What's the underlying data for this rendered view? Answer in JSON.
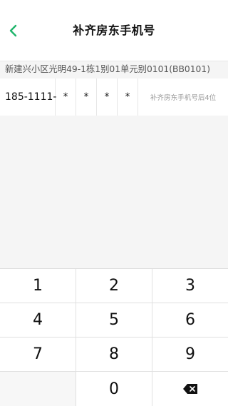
{
  "header": {
    "title": "补齐房东手机号",
    "back_icon": "chevron-left-icon",
    "accent_color": "#1fb56b"
  },
  "address": {
    "text": "新建兴小区光明49-1栋1别01单元别0101(BB0101)"
  },
  "phone": {
    "prefix": "185-1111-",
    "digits": [
      "*",
      "*",
      "*",
      "*"
    ],
    "hint": "补齐房东手机号后4位"
  },
  "keypad": {
    "keys": [
      "1",
      "2",
      "3",
      "4",
      "5",
      "6",
      "7",
      "8",
      "9",
      "",
      "0",
      "⌫"
    ],
    "delete_icon": "backspace-icon"
  }
}
